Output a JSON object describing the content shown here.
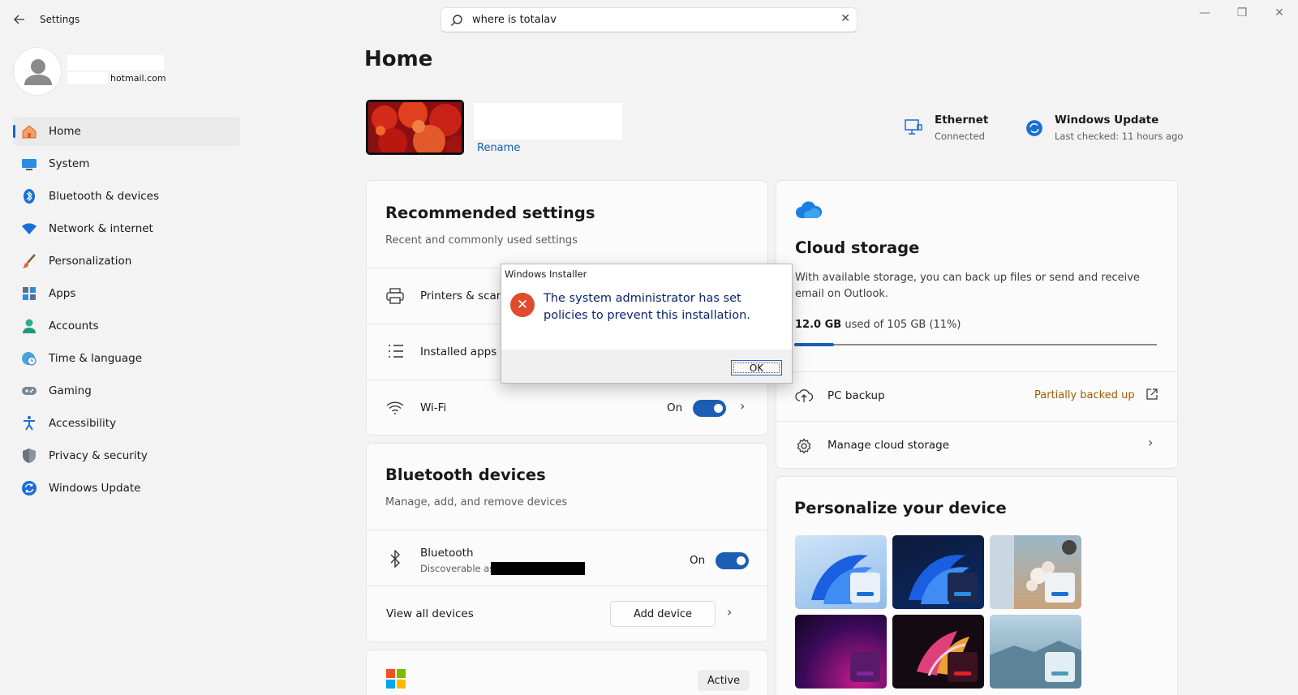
{
  "app": {
    "title": "Settings"
  },
  "search": {
    "value": "where is totalav"
  },
  "user": {
    "email_suffix": "hotmail.com"
  },
  "sidebar": {
    "items": [
      {
        "label": "Home",
        "icon": "home-icon",
        "active": true
      },
      {
        "label": "System",
        "icon": "system-icon"
      },
      {
        "label": "Bluetooth & devices",
        "icon": "bluetooth-icon"
      },
      {
        "label": "Network & internet",
        "icon": "wifi-icon"
      },
      {
        "label": "Personalization",
        "icon": "brush-icon"
      },
      {
        "label": "Apps",
        "icon": "apps-icon"
      },
      {
        "label": "Accounts",
        "icon": "accounts-icon"
      },
      {
        "label": "Time & language",
        "icon": "globe-clock-icon"
      },
      {
        "label": "Gaming",
        "icon": "gamepad-icon"
      },
      {
        "label": "Accessibility",
        "icon": "accessibility-icon"
      },
      {
        "label": "Privacy & security",
        "icon": "shield-icon"
      },
      {
        "label": "Windows Update",
        "icon": "update-icon"
      }
    ]
  },
  "main": {
    "title": "Home",
    "rename_label": "Rename",
    "status": {
      "ethernet": {
        "title": "Ethernet",
        "sub": "Connected"
      },
      "update": {
        "title": "Windows Update",
        "sub": "Last checked: 11 hours ago"
      }
    },
    "recommended": {
      "title": "Recommended settings",
      "subtitle": "Recent and commonly used settings",
      "rows": [
        {
          "label": "Printers & scann"
        },
        {
          "label": "Installed apps"
        },
        {
          "label": "Wi-Fi",
          "state": "On"
        }
      ]
    },
    "bluetooth": {
      "title": "Bluetooth devices",
      "subtitle": "Manage, add, and remove devices",
      "device_label": "Bluetooth",
      "device_sub": "Discoverable as",
      "state": "On",
      "view_all": "View all devices",
      "add_device": "Add device"
    },
    "m365": {
      "badge": "Active"
    },
    "cloud": {
      "title": "Cloud storage",
      "desc": "With available storage, you can back up files or send and receive email on Outlook.",
      "used": "12.0 GB",
      "used_suffix": "used of 105 GB (11%)",
      "used_fraction": 0.11,
      "backup_label": "PC backup",
      "backup_status": "Partially backed up",
      "manage_label": "Manage cloud storage"
    },
    "personalize": {
      "title": "Personalize your device"
    }
  },
  "dialog": {
    "title": "Windows Installer",
    "message": "The system administrator has set policies to prevent this installation.",
    "ok": "OK"
  },
  "colors": {
    "accent": "#1a5fb4",
    "warning_text": "#a25a00",
    "error": "#e04c2c"
  }
}
